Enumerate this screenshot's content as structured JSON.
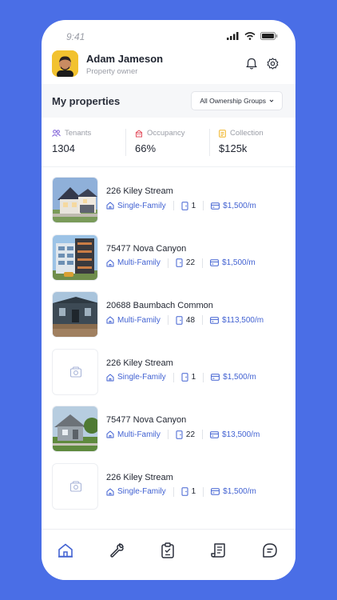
{
  "status": {
    "time": "9:41"
  },
  "user": {
    "name": "Adam Jameson",
    "role": "Property owner"
  },
  "section": {
    "title": "My properties",
    "group_select": "All Ownership Groups"
  },
  "stats": [
    {
      "label": "Tenants",
      "value": "1304",
      "icon": "tenants-icon",
      "color": "#7b5cd6"
    },
    {
      "label": "Occupancy",
      "value": "66%",
      "icon": "occupancy-icon",
      "color": "#e24b5b"
    },
    {
      "label": "Collection",
      "value": "$125k",
      "icon": "collection-icon",
      "color": "#f0b323"
    }
  ],
  "properties": [
    {
      "name": "226 Kiley Stream",
      "type": "Single-Family",
      "units": "1",
      "rent": "$1,500/m",
      "image": "house"
    },
    {
      "name": "75477 Nova Canyon",
      "type": "Multi-Family",
      "units": "22",
      "rent": "$1,500/m",
      "image": "apartment"
    },
    {
      "name": "20688 Baumbach Common",
      "type": "Multi-Family",
      "units": "48",
      "rent": "$113,500/m",
      "image": "construction"
    },
    {
      "name": "226 Kiley Stream",
      "type": "Single-Family",
      "units": "1",
      "rent": "$1,500/m",
      "image": "placeholder"
    },
    {
      "name": "75477 Nova Canyon",
      "type": "Multi-Family",
      "units": "22",
      "rent": "$13,500/m",
      "image": "grey-house"
    },
    {
      "name": "226 Kiley Stream",
      "type": "Single-Family",
      "units": "1",
      "rent": "$1,500/m",
      "image": "placeholder"
    }
  ],
  "tabs": [
    {
      "name": "home",
      "icon": "home-icon",
      "active": true
    },
    {
      "name": "maintenance",
      "icon": "wrench-icon",
      "active": false
    },
    {
      "name": "tasks",
      "icon": "clipboard-icon",
      "active": false
    },
    {
      "name": "documents",
      "icon": "documents-icon",
      "active": false
    },
    {
      "name": "messages",
      "icon": "chat-icon",
      "active": false
    }
  ],
  "colors": {
    "accent": "#4262d2",
    "background": "#4a6ee6"
  }
}
